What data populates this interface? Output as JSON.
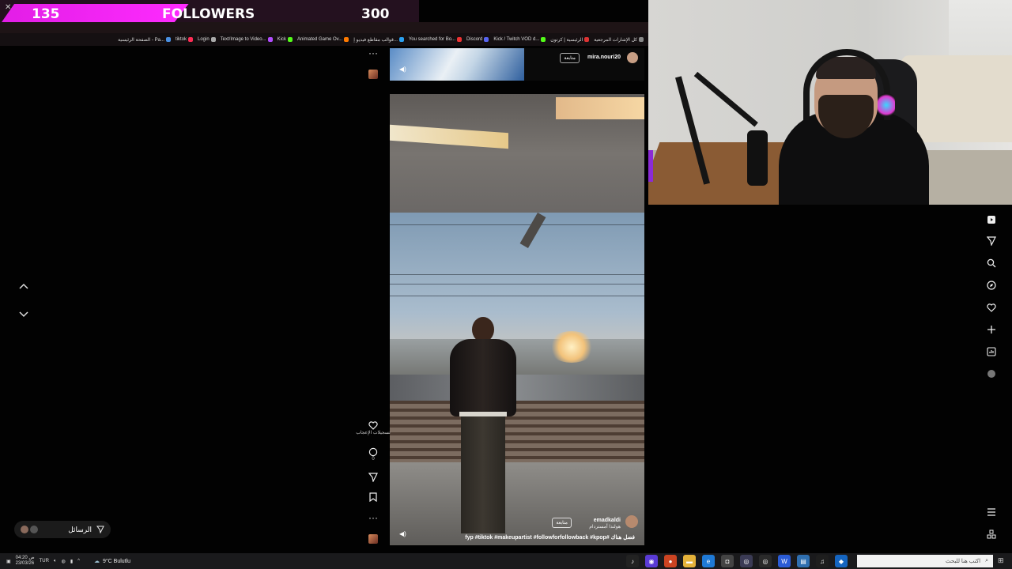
{
  "overlay": {
    "follower_count": "135",
    "follower_label": "FOLLOWERS",
    "follower_goal": "300",
    "follower_progress": 0.45,
    "accent_color": "#ff2bff"
  },
  "browser": {
    "bookmarks": [
      {
        "label": "كل الإشارات المرجعية",
        "color": "#888"
      },
      {
        "label": "الرئيسية | كرتون",
        "color": "#d33"
      },
      {
        "label": "Kick / Twitch VOD d...",
        "color": "#53fc18"
      },
      {
        "label": "Discord",
        "color": "#5865f2"
      },
      {
        "label": "You searched for Bo...",
        "color": "#e33"
      },
      {
        "label": "قوالب مقاطع فيديو إ...",
        "color": "#2aa0f0"
      },
      {
        "label": "Animated Game Ov...",
        "color": "#ff7a00"
      },
      {
        "label": "Kick",
        "color": "#53fc18"
      },
      {
        "label": "Text/Image to Video...",
        "color": "#b24cff"
      },
      {
        "label": "Login",
        "color": "#aaa"
      },
      {
        "label": "tiktok",
        "color": "#fe2c55"
      },
      {
        "label": "الصفحة الرئيسية - Pa...",
        "color": "#4a90e2"
      }
    ]
  },
  "feed": {
    "top_video": {
      "username": "mira.nouri20",
      "follow_label": "متابعة"
    },
    "video": {
      "username": "emadkaldi",
      "location": "هولندا أمستردام",
      "follow_label": "متابعة",
      "caption": "fyp #tiktok #makeupartist #followforfollowback #kpop# فضل هناك"
    },
    "actions": {
      "likes_label": "تسجيلات الإعجاب",
      "comments_count": "0",
      "more_label": "···"
    },
    "messages_label": "الرسائل"
  },
  "sidebar_icons": [
    "play-icon",
    "send-icon",
    "search-icon",
    "compass-icon",
    "heart-icon",
    "plus-icon",
    "stats-icon",
    "avatar-icon",
    "menu-icon",
    "apps-icon"
  ],
  "taskbar": {
    "time": "ص 04:20",
    "date": "23/03/26",
    "language": "TUR",
    "weather": "9°C  Bulutlu",
    "search_placeholder": "اكتب هنا للبحث"
  }
}
